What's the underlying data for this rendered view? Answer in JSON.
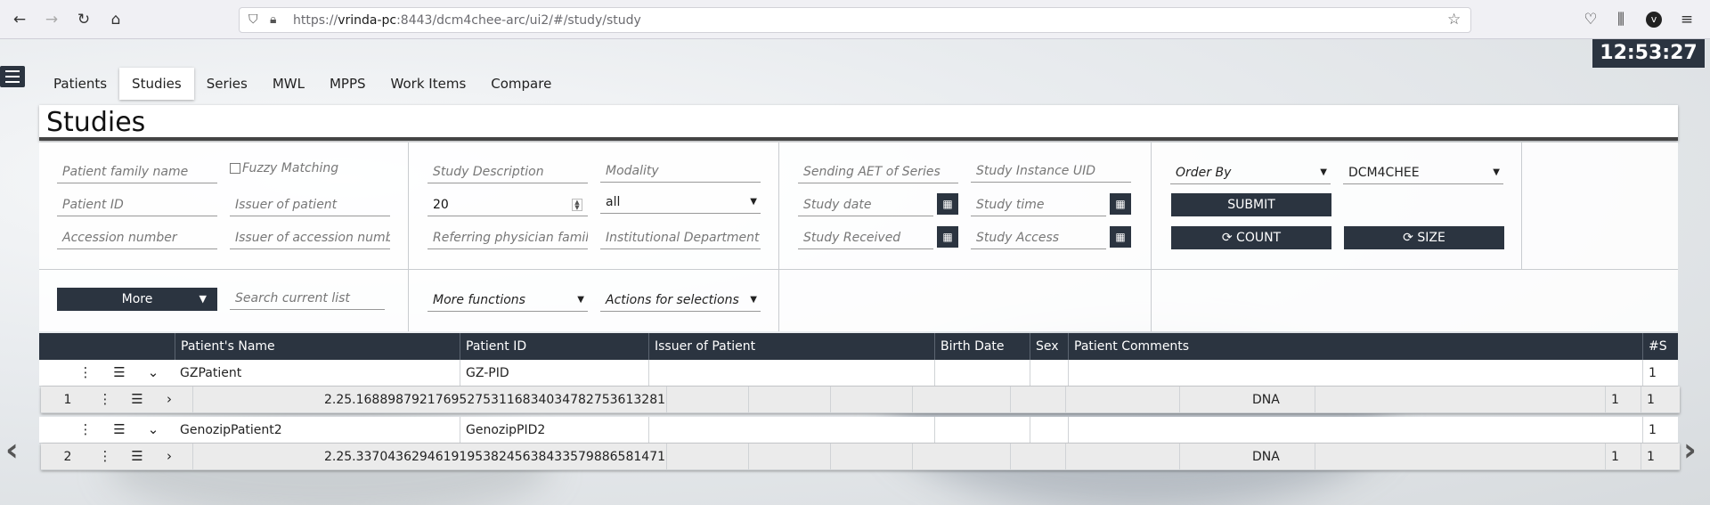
{
  "browser": {
    "url_prefix": "https://",
    "url_host": "vrinda-pc",
    "url_rest": ":8443/dcm4chee-arc/ui2/#/study/study"
  },
  "clock": "12:53:27",
  "tabs": [
    "Patients",
    "Studies",
    "Series",
    "MWL",
    "MPPS",
    "Work Items",
    "Compare"
  ],
  "page_title": "Studies",
  "filters": {
    "patient_family_name": "Patient family name",
    "fuzzy_matching": "Fuzzy Matching",
    "patient_id": "Patient ID",
    "issuer_of_patient": "Issuer of patient",
    "accession_number": "Accession number",
    "issuer_of_accession": "Issuer of accession number",
    "study_description": "Study Description",
    "modality": "Modality",
    "limit_value": "20",
    "modality_value": "all",
    "referring_physician": "Referring physician family name",
    "institutional_department": "Institutional Department Name",
    "sending_aet": "Sending AET of Series",
    "study_instance_uid": "Study Instance UID",
    "study_date": "Study date",
    "study_time": "Study time",
    "study_received": "Study Received",
    "study_access": "Study Access",
    "order_by": "Order By",
    "aet": "DCM4CHEE",
    "submit": "SUBMIT",
    "count": "COUNT",
    "size": "SIZE",
    "more": "More",
    "search_current_list": "Search current list",
    "more_functions": "More functions",
    "actions_for_selections": "Actions for selections"
  },
  "table": {
    "headers": [
      "Patient's Name",
      "Patient ID",
      "Issuer of Patient",
      "Birth Date",
      "Sex",
      "Patient Comments",
      "#S"
    ],
    "patients": [
      {
        "name": "GZPatient",
        "id": "GZ-PID",
        "num_studies": "1",
        "study": {
          "index": "1",
          "uid": "2.25.168898792176952753116834034782753613281",
          "modality": "DNA",
          "count_a": "1",
          "count_b": "1"
        }
      },
      {
        "name": "GenozipPatient2",
        "id": "GenozipPID2",
        "num_studies": "1",
        "study": {
          "index": "2",
          "uid": "2.25.337043629461919538245638433579886581471",
          "modality": "DNA",
          "count_a": "1",
          "count_b": "1"
        }
      }
    ]
  }
}
